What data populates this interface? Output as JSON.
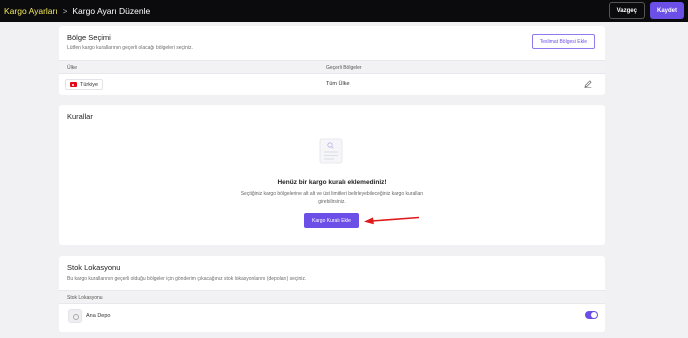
{
  "header": {
    "breadcrumb_root": "Kargo Ayarları",
    "breadcrumb_separator": ">",
    "title": "Kargo Ayarı Düzenle",
    "cancel_label": "Vazgeç",
    "save_label": "Kaydet"
  },
  "region_section": {
    "title": "Bölge Seçimi",
    "subtitle": "Lütfen kargo kurallarının geçerli olacağı bölgeleri seçiniz.",
    "add_button": "Teslimat Bölgesi Ekle",
    "columns": [
      "Ülke",
      "Geçerli Bölgeler"
    ],
    "rows": [
      {
        "country": "Türkiye",
        "regions": "Tüm Ülke"
      }
    ]
  },
  "rules_section": {
    "title": "Kurallar",
    "empty_title": "Henüz bir kargo kuralı eklemediniz!",
    "empty_description": "Seçtiğiniz kargo bölgelerine alt alt ve üst limitleri belirleyebileceğiniz kargo kuralları girebilirsiniz.",
    "add_button": "Kargo Kuralı Ekle"
  },
  "stock_section": {
    "title": "Stok Lokasyonu",
    "subtitle": "Bu kargo kurallarının geçerli olduğu bölgeler için gönderim çıkacağınız stok lokasyonlarını (depoları) seçiniz.",
    "column": "Stok Lokasyonu",
    "rows": [
      {
        "name": "Ana Depo",
        "enabled": true
      }
    ]
  },
  "colors": {
    "accent": "#6c4fe6",
    "topbar": "#0b0b0d",
    "breadcrumb_root": "#f2e85a",
    "annotation_arrow": "#e0191b"
  }
}
